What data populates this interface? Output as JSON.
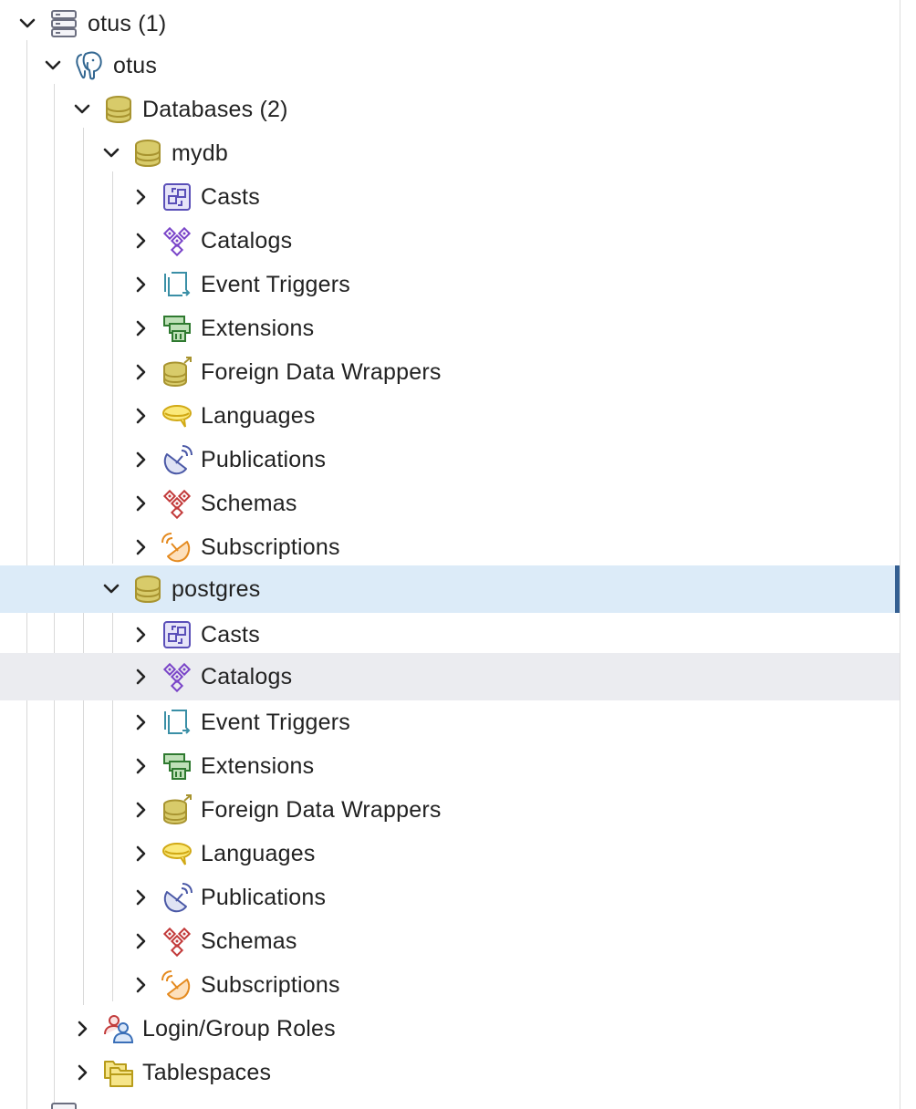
{
  "tree": {
    "server_group": {
      "label": "otus (1)",
      "icon": "server-group-icon",
      "expanded": true
    },
    "server": {
      "label": "otus",
      "icon": "postgres-elephant-icon",
      "expanded": true
    },
    "databases": {
      "label": "Databases (2)",
      "icon": "database-icon",
      "expanded": true
    },
    "mydb": {
      "label": "mydb",
      "icon": "database-icon",
      "expanded": true,
      "children": [
        {
          "label": "Casts",
          "icon": "cast-icon"
        },
        {
          "label": "Catalogs",
          "icon": "catalog-icon"
        },
        {
          "label": "Event Triggers",
          "icon": "event-trigger-icon"
        },
        {
          "label": "Extensions",
          "icon": "extension-icon"
        },
        {
          "label": "Foreign Data Wrappers",
          "icon": "foreign-data-wrapper-icon"
        },
        {
          "label": "Languages",
          "icon": "language-icon"
        },
        {
          "label": "Publications",
          "icon": "publication-icon"
        },
        {
          "label": "Schemas",
          "icon": "schema-icon"
        },
        {
          "label": "Subscriptions",
          "icon": "subscription-icon"
        }
      ]
    },
    "postgres": {
      "label": "postgres",
      "icon": "database-icon",
      "expanded": true,
      "selected": true,
      "children": [
        {
          "label": "Casts",
          "icon": "cast-icon"
        },
        {
          "label": "Catalogs",
          "icon": "catalog-icon",
          "hovered": true
        },
        {
          "label": "Event Triggers",
          "icon": "event-trigger-icon"
        },
        {
          "label": "Extensions",
          "icon": "extension-icon"
        },
        {
          "label": "Foreign Data Wrappers",
          "icon": "foreign-data-wrapper-icon"
        },
        {
          "label": "Languages",
          "icon": "language-icon"
        },
        {
          "label": "Publications",
          "icon": "publication-icon"
        },
        {
          "label": "Schemas",
          "icon": "schema-icon"
        },
        {
          "label": "Subscriptions",
          "icon": "subscription-icon"
        }
      ]
    },
    "login_roles": {
      "label": "Login/Group Roles",
      "icon": "login-role-icon"
    },
    "tablespaces": {
      "label": "Tablespaces",
      "icon": "tablespace-icon"
    }
  },
  "colors": {
    "selected_bg": "#dcebf8",
    "selected_bar": "#345f92",
    "hover_bg": "#ebecf0",
    "database_icon": "#b4a336"
  }
}
